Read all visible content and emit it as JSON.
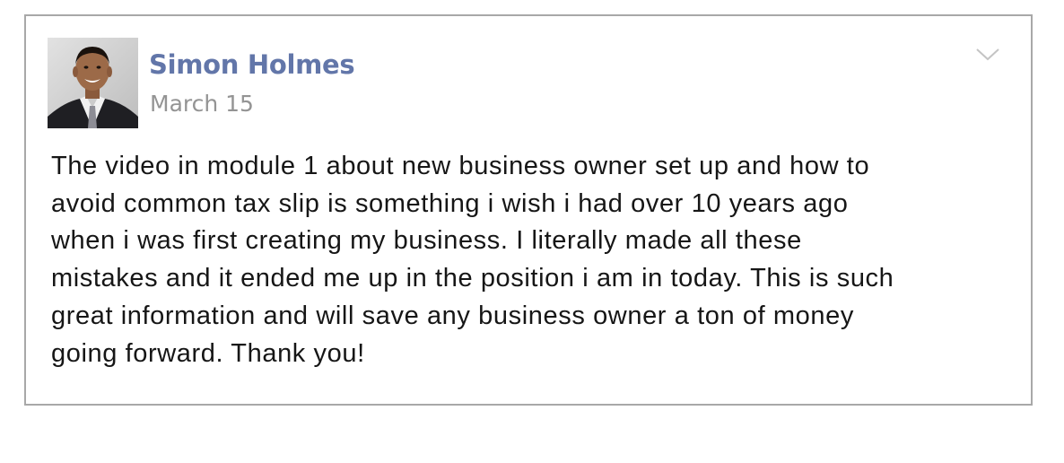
{
  "post": {
    "author_name": "Simon Holmes",
    "date": "March 15",
    "body": "The video in module 1 about new business owner set up and how to\navoid common tax slip is something i wish i had over 10 years ago\nwhen i was first creating my business. I literally made all these\nmistakes and it ended me up in the position i am in today. This is such\ngreat information and will save any business owner a ton of money\ngoing forward. Thank you!",
    "avatar_icon": "profile-photo",
    "menu_icon": "chevron-down-icon"
  },
  "colors": {
    "author_name": "#6276a9",
    "date": "#949494",
    "border": "#a8a8a8",
    "body_text": "#161616"
  }
}
